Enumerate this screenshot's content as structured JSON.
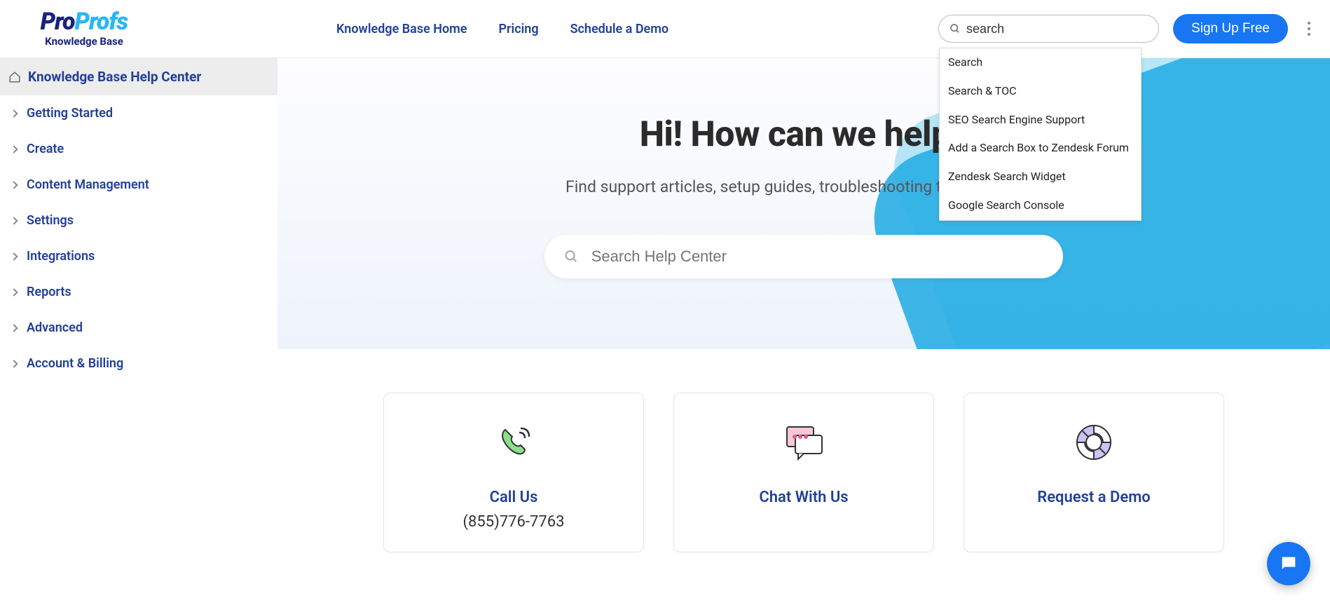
{
  "logo": {
    "part1": "Pro",
    "part2": "Profs",
    "sub": "Knowledge Base"
  },
  "topnav": [
    {
      "label": "Knowledge Base Home"
    },
    {
      "label": "Pricing"
    },
    {
      "label": "Schedule a Demo"
    }
  ],
  "header_search": {
    "value": "search"
  },
  "signup_label": "Sign Up Free",
  "search_suggestions": [
    "Search",
    "Search & TOC",
    "SEO Search Engine Support",
    "Add a Search Box to Zendesk Forum",
    "Zendesk Search Widget",
    "Google Search Console"
  ],
  "sidebar": {
    "header": "Knowledge Base Help Center",
    "items": [
      "Getting Started",
      "Create",
      "Content Management",
      "Settings",
      "Integrations",
      "Reports",
      "Advanced",
      "Account & Billing"
    ]
  },
  "hero": {
    "title": "Hi! How can we help?",
    "subtitle": "Find support articles, setup guides, troubleshooting tips, and more.",
    "search_placeholder": "Search Help Center"
  },
  "cards": [
    {
      "title": "Call Us",
      "sub": "(855)776-7763"
    },
    {
      "title": "Chat With Us",
      "sub": ""
    },
    {
      "title": "Request a Demo",
      "sub": ""
    }
  ]
}
